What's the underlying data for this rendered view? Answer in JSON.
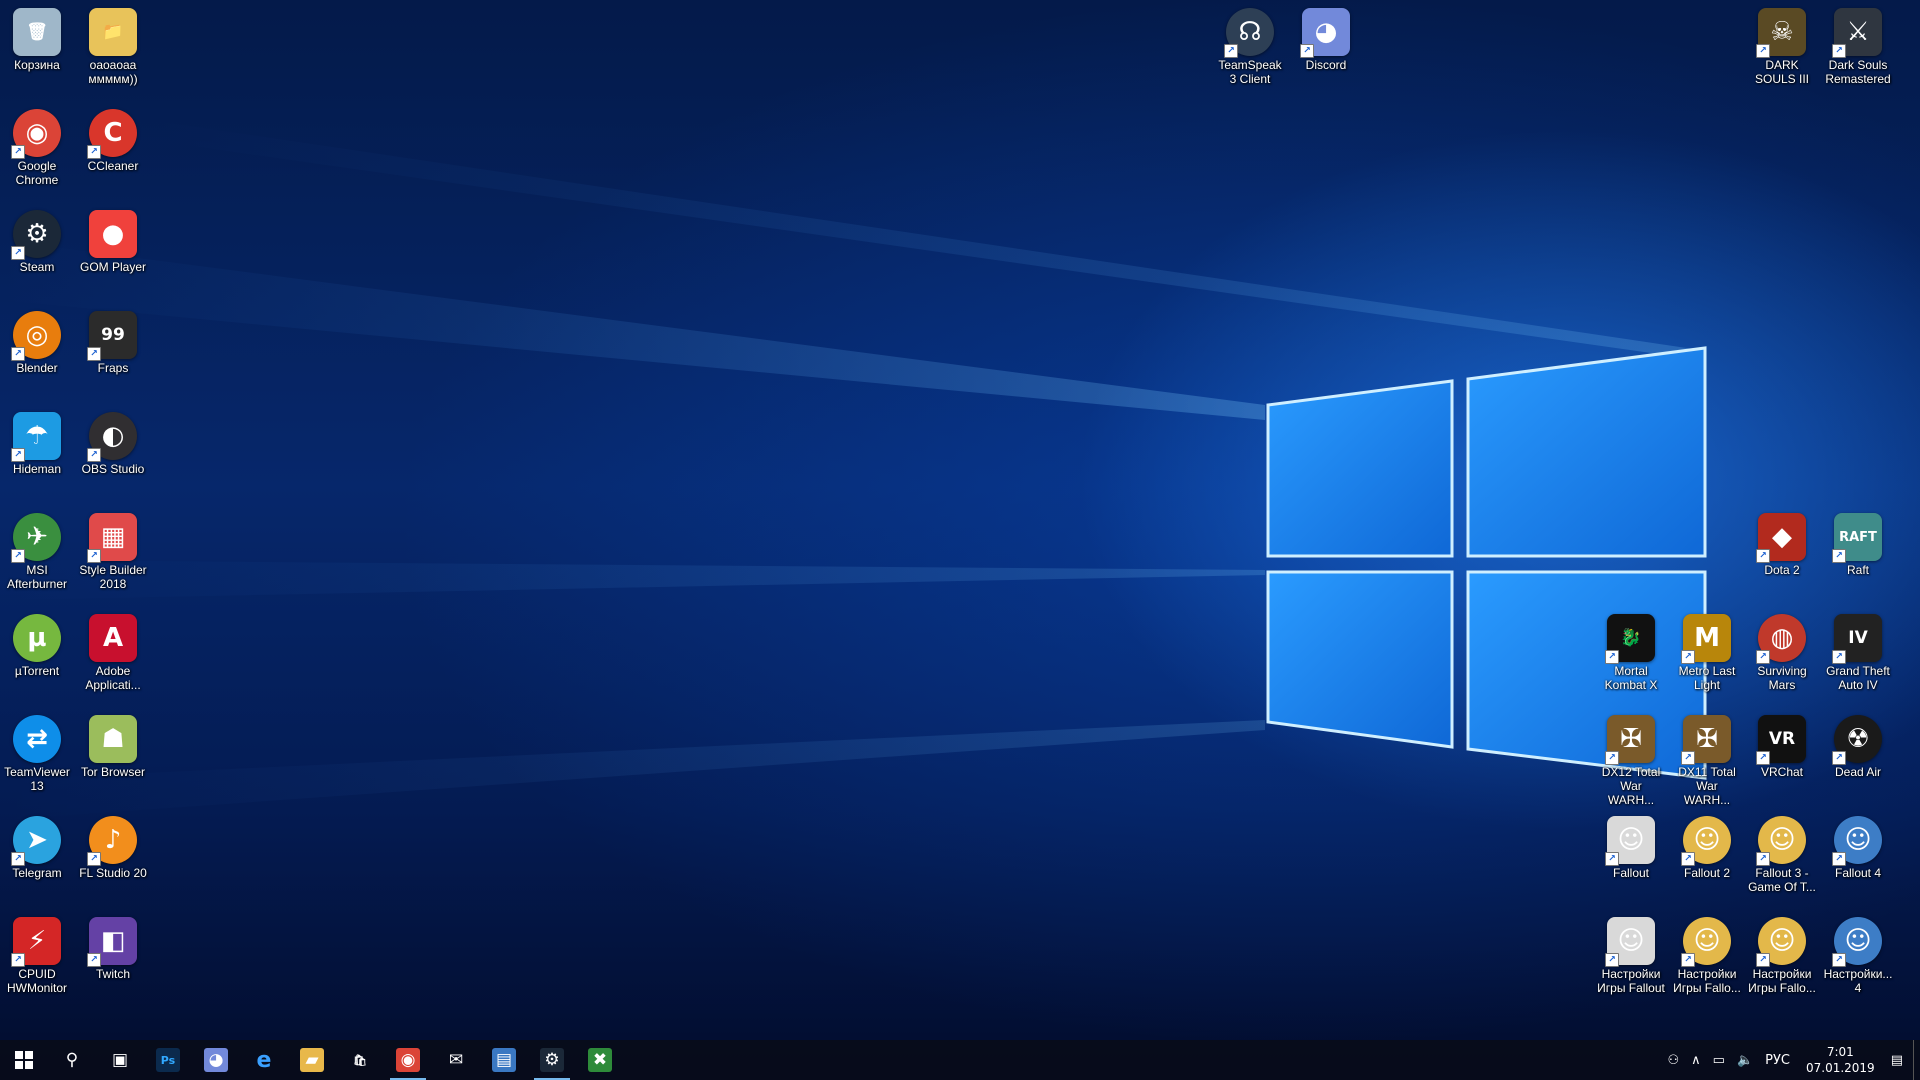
{
  "desktop_icons": [
    {
      "id": "recycle-bin",
      "label": "Корзина",
      "col": 0,
      "row": 0,
      "glyph": "🗑",
      "bg": "#9fb7c9",
      "round": false,
      "shortcut": false
    },
    {
      "id": "folder",
      "label": "оаоаоаа ммммм))",
      "col": 1,
      "row": 0,
      "glyph": "📁",
      "bg": "#e8c35a",
      "round": false,
      "shortcut": false
    },
    {
      "id": "google-chrome",
      "label": "Google Chrome",
      "col": 0,
      "row": 1,
      "glyph": "◉",
      "bg": "#db4437",
      "round": true,
      "shortcut": true
    },
    {
      "id": "ccleaner",
      "label": "CCleaner",
      "col": 1,
      "row": 1,
      "glyph": "C",
      "bg": "#d9362b",
      "round": true,
      "shortcut": true
    },
    {
      "id": "steam",
      "label": "Steam",
      "col": 0,
      "row": 2,
      "glyph": "⚙",
      "bg": "#1b2838",
      "round": true,
      "shortcut": true
    },
    {
      "id": "gom-player",
      "label": "GOM Player",
      "col": 1,
      "row": 2,
      "glyph": "●",
      "bg": "#f0413c",
      "round": false,
      "shortcut": false
    },
    {
      "id": "blender",
      "label": "Blender",
      "col": 0,
      "row": 3,
      "glyph": "◎",
      "bg": "#e87d0d",
      "round": true,
      "shortcut": true
    },
    {
      "id": "fraps",
      "label": "Fraps",
      "col": 1,
      "row": 3,
      "glyph": "99",
      "bg": "#2b2b2b",
      "round": false,
      "shortcut": true
    },
    {
      "id": "hideman",
      "label": "Hideman",
      "col": 0,
      "row": 4,
      "glyph": "☂",
      "bg": "#1d9be3",
      "round": false,
      "shortcut": true
    },
    {
      "id": "obs-studio",
      "label": "OBS Studio",
      "col": 1,
      "row": 4,
      "glyph": "◐",
      "bg": "#302e31",
      "round": true,
      "shortcut": true
    },
    {
      "id": "msi-afterburner",
      "label": "MSI Afterburner",
      "col": 0,
      "row": 5,
      "glyph": "✈",
      "bg": "#3a8f3f",
      "round": true,
      "shortcut": true
    },
    {
      "id": "style-builder",
      "label": "Style Builder 2018",
      "col": 1,
      "row": 5,
      "glyph": "▦",
      "bg": "#e04a4a",
      "round": false,
      "shortcut": true
    },
    {
      "id": "utorrent",
      "label": "µTorrent",
      "col": 0,
      "row": 6,
      "glyph": "µ",
      "bg": "#76b83f",
      "round": true,
      "shortcut": false
    },
    {
      "id": "adobe-application",
      "label": "Adobe Applicati...",
      "col": 1,
      "row": 6,
      "glyph": "A",
      "bg": "#c8102e",
      "round": false,
      "shortcut": false
    },
    {
      "id": "teamviewer",
      "label": "TeamViewer 13",
      "col": 0,
      "row": 7,
      "glyph": "⇄",
      "bg": "#0e8ee9",
      "round": true,
      "shortcut": false
    },
    {
      "id": "tor-browser",
      "label": "Tor Browser",
      "col": 1,
      "row": 7,
      "glyph": "☗",
      "bg": "#9bbd5c",
      "round": false,
      "shortcut": false
    },
    {
      "id": "telegram",
      "label": "Telegram",
      "col": 0,
      "row": 8,
      "glyph": "➤",
      "bg": "#2aa3df",
      "round": true,
      "shortcut": true
    },
    {
      "id": "fl-studio",
      "label": "FL Studio 20",
      "col": 1,
      "row": 8,
      "glyph": "♪",
      "bg": "#f28e1c",
      "round": true,
      "shortcut": true
    },
    {
      "id": "cpuid-hwmonitor",
      "label": "CPUID HWMonitor",
      "col": 0,
      "row": 9,
      "glyph": "⚡",
      "bg": "#d42626",
      "round": false,
      "shortcut": true
    },
    {
      "id": "twitch",
      "label": "Twitch",
      "col": 1,
      "row": 9,
      "glyph": "◧",
      "bg": "#6441a5",
      "round": false,
      "shortcut": true
    },
    {
      "id": "teamspeak",
      "label": "TeamSpeak 3 Client",
      "col": "ts",
      "row": 0,
      "glyph": "☊",
      "bg": "#2d3f55",
      "round": true,
      "shortcut": true
    },
    {
      "id": "discord",
      "label": "Discord",
      "col": "dc",
      "row": 0,
      "glyph": "◕",
      "bg": "#7289da",
      "round": false,
      "shortcut": true
    },
    {
      "id": "dark-souls-3",
      "label": "DARK SOULS III",
      "col": "r1",
      "row": 0,
      "glyph": "☠",
      "bg": "#5a4a24",
      "round": false,
      "shortcut": true
    },
    {
      "id": "dark-souls-remastered",
      "label": "Dark Souls Remastered",
      "col": "r0",
      "row": 0,
      "glyph": "⚔",
      "bg": "#2f3640",
      "round": false,
      "shortcut": true
    },
    {
      "id": "dota-2",
      "label": "Dota 2",
      "col": "r1",
      "row": 5,
      "glyph": "◆",
      "bg": "#b22a1e",
      "round": false,
      "shortcut": true
    },
    {
      "id": "raft",
      "label": "Raft",
      "col": "r0",
      "row": 5,
      "glyph": "RAFT",
      "bg": "#3f8c8a",
      "round": false,
      "shortcut": true
    },
    {
      "id": "mortal-kombat-x",
      "label": "Mortal Kombat X",
      "col": "r3",
      "row": 6,
      "glyph": "🐉",
      "bg": "#111111",
      "round": false,
      "shortcut": true
    },
    {
      "id": "metro-last-light",
      "label": "Metro Last Light",
      "col": "r2",
      "row": 6,
      "glyph": "M",
      "bg": "#b8860b",
      "round": false,
      "shortcut": true
    },
    {
      "id": "surviving-mars",
      "label": "Surviving Mars",
      "col": "r1",
      "row": 6,
      "glyph": "◍",
      "bg": "#c0392b",
      "round": true,
      "shortcut": true
    },
    {
      "id": "gta-4",
      "label": "Grand Theft Auto IV",
      "col": "r0",
      "row": 6,
      "glyph": "IV",
      "bg": "#222222",
      "round": false,
      "shortcut": true
    },
    {
      "id": "dx12-total-war",
      "label": "DX12 Total War WARH...",
      "col": "r3",
      "row": 7,
      "glyph": "✠",
      "bg": "#7a5a2a",
      "round": false,
      "shortcut": true
    },
    {
      "id": "dx11-total-war",
      "label": "DX11 Total War WARH...",
      "col": "r2",
      "row": 7,
      "glyph": "✠",
      "bg": "#7a5a2a",
      "round": false,
      "shortcut": true
    },
    {
      "id": "vrchat",
      "label": "VRChat",
      "col": "r1",
      "row": 7,
      "glyph": "VR",
      "bg": "#111111",
      "round": false,
      "shortcut": true
    },
    {
      "id": "dead-air",
      "label": "Dead Air",
      "col": "r0",
      "row": 7,
      "glyph": "☢",
      "bg": "#1a1a1a",
      "round": true,
      "shortcut": true
    },
    {
      "id": "fallout",
      "label": "Fallout",
      "col": "r3",
      "row": 8,
      "glyph": "☺",
      "bg": "#d9d9d9",
      "round": false,
      "shortcut": true
    },
    {
      "id": "fallout-2",
      "label": "Fallout 2",
      "col": "r2",
      "row": 8,
      "glyph": "☺",
      "bg": "#e3b84a",
      "round": true,
      "shortcut": true
    },
    {
      "id": "fallout-3",
      "label": "Fallout 3 - Game Of T...",
      "col": "r1",
      "row": 8,
      "glyph": "☺",
      "bg": "#e3b84a",
      "round": true,
      "shortcut": true
    },
    {
      "id": "fallout-4",
      "label": "Fallout 4",
      "col": "r0",
      "row": 8,
      "glyph": "☺",
      "bg": "#3d7dc6",
      "round": true,
      "shortcut": true
    },
    {
      "id": "fallout-settings",
      "label": "Настройки Игры Fallout",
      "col": "r3",
      "row": 9,
      "glyph": "☺",
      "bg": "#d9d9d9",
      "round": false,
      "shortcut": true
    },
    {
      "id": "fallout-2-settings",
      "label": "Настройки Игры Fallo...",
      "col": "r2",
      "row": 9,
      "glyph": "☺",
      "bg": "#e3b84a",
      "round": true,
      "shortcut": true
    },
    {
      "id": "fallout-3-settings",
      "label": "Настройки Игры Fallo...",
      "col": "r1",
      "row": 9,
      "glyph": "☺",
      "bg": "#e3b84a",
      "round": true,
      "shortcut": true
    },
    {
      "id": "fallout-4-settings",
      "label": "Настройки... 4",
      "col": "r0",
      "row": 9,
      "glyph": "☺",
      "bg": "#3d7dc6",
      "round": true,
      "shortcut": true
    }
  ],
  "taskbar": {
    "start_icon": "windows-logo-icon",
    "pinned": [
      {
        "id": "search",
        "icon": "search-icon",
        "glyph": "⚲",
        "bg": "transparent"
      },
      {
        "id": "task-view",
        "icon": "task-view-icon",
        "glyph": "▣",
        "bg": "transparent"
      },
      {
        "id": "photoshop",
        "icon": "photoshop-icon",
        "glyph": "Ps",
        "bg": "#0b2a4d"
      },
      {
        "id": "discord",
        "icon": "discord-icon",
        "glyph": "◕",
        "bg": "#7289da"
      },
      {
        "id": "edge",
        "icon": "edge-icon",
        "glyph": "e",
        "bg": "transparent"
      },
      {
        "id": "file-explorer",
        "icon": "folder-icon",
        "glyph": "▰",
        "bg": "#e8b84a"
      },
      {
        "id": "store",
        "icon": "store-icon",
        "glyph": "🛍",
        "bg": "transparent"
      },
      {
        "id": "chrome",
        "icon": "chrome-icon",
        "glyph": "◉",
        "bg": "#db4437",
        "active": true
      },
      {
        "id": "mail",
        "icon": "mail-icon",
        "glyph": "✉",
        "bg": "transparent"
      },
      {
        "id": "window",
        "icon": "window-icon",
        "glyph": "▤",
        "bg": "#3a78c2"
      },
      {
        "id": "steam",
        "icon": "steam-icon",
        "glyph": "⚙",
        "bg": "#1b2838",
        "active": true
      },
      {
        "id": "xbox",
        "icon": "xbox-icon",
        "glyph": "✖",
        "bg": "#2e8b3a"
      }
    ],
    "tray": {
      "people_icon": "people-icon",
      "chevron_icon": "chevron-up-icon",
      "network_icon": "network-icon",
      "volume_icon": "volume-icon",
      "language": "РУС",
      "time": "7:01",
      "date": "07.01.2019",
      "notification_icon": "notification-icon"
    }
  }
}
